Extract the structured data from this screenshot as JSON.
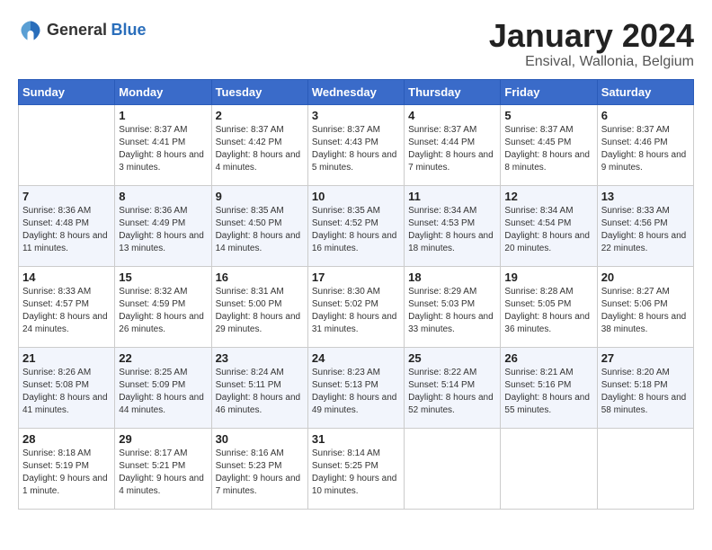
{
  "logo": {
    "general": "General",
    "blue": "Blue"
  },
  "title": "January 2024",
  "subtitle": "Ensival, Wallonia, Belgium",
  "days_header": [
    "Sunday",
    "Monday",
    "Tuesday",
    "Wednesday",
    "Thursday",
    "Friday",
    "Saturday"
  ],
  "weeks": [
    [
      {
        "day": "",
        "info": ""
      },
      {
        "day": "1",
        "info": "Sunrise: 8:37 AM\nSunset: 4:41 PM\nDaylight: 8 hours\nand 3 minutes."
      },
      {
        "day": "2",
        "info": "Sunrise: 8:37 AM\nSunset: 4:42 PM\nDaylight: 8 hours\nand 4 minutes."
      },
      {
        "day": "3",
        "info": "Sunrise: 8:37 AM\nSunset: 4:43 PM\nDaylight: 8 hours\nand 5 minutes."
      },
      {
        "day": "4",
        "info": "Sunrise: 8:37 AM\nSunset: 4:44 PM\nDaylight: 8 hours\nand 7 minutes."
      },
      {
        "day": "5",
        "info": "Sunrise: 8:37 AM\nSunset: 4:45 PM\nDaylight: 8 hours\nand 8 minutes."
      },
      {
        "day": "6",
        "info": "Sunrise: 8:37 AM\nSunset: 4:46 PM\nDaylight: 8 hours\nand 9 minutes."
      }
    ],
    [
      {
        "day": "7",
        "info": "Sunrise: 8:36 AM\nSunset: 4:48 PM\nDaylight: 8 hours\nand 11 minutes."
      },
      {
        "day": "8",
        "info": "Sunrise: 8:36 AM\nSunset: 4:49 PM\nDaylight: 8 hours\nand 13 minutes."
      },
      {
        "day": "9",
        "info": "Sunrise: 8:35 AM\nSunset: 4:50 PM\nDaylight: 8 hours\nand 14 minutes."
      },
      {
        "day": "10",
        "info": "Sunrise: 8:35 AM\nSunset: 4:52 PM\nDaylight: 8 hours\nand 16 minutes."
      },
      {
        "day": "11",
        "info": "Sunrise: 8:34 AM\nSunset: 4:53 PM\nDaylight: 8 hours\nand 18 minutes."
      },
      {
        "day": "12",
        "info": "Sunrise: 8:34 AM\nSunset: 4:54 PM\nDaylight: 8 hours\nand 20 minutes."
      },
      {
        "day": "13",
        "info": "Sunrise: 8:33 AM\nSunset: 4:56 PM\nDaylight: 8 hours\nand 22 minutes."
      }
    ],
    [
      {
        "day": "14",
        "info": "Sunrise: 8:33 AM\nSunset: 4:57 PM\nDaylight: 8 hours\nand 24 minutes."
      },
      {
        "day": "15",
        "info": "Sunrise: 8:32 AM\nSunset: 4:59 PM\nDaylight: 8 hours\nand 26 minutes."
      },
      {
        "day": "16",
        "info": "Sunrise: 8:31 AM\nSunset: 5:00 PM\nDaylight: 8 hours\nand 29 minutes."
      },
      {
        "day": "17",
        "info": "Sunrise: 8:30 AM\nSunset: 5:02 PM\nDaylight: 8 hours\nand 31 minutes."
      },
      {
        "day": "18",
        "info": "Sunrise: 8:29 AM\nSunset: 5:03 PM\nDaylight: 8 hours\nand 33 minutes."
      },
      {
        "day": "19",
        "info": "Sunrise: 8:28 AM\nSunset: 5:05 PM\nDaylight: 8 hours\nand 36 minutes."
      },
      {
        "day": "20",
        "info": "Sunrise: 8:27 AM\nSunset: 5:06 PM\nDaylight: 8 hours\nand 38 minutes."
      }
    ],
    [
      {
        "day": "21",
        "info": "Sunrise: 8:26 AM\nSunset: 5:08 PM\nDaylight: 8 hours\nand 41 minutes."
      },
      {
        "day": "22",
        "info": "Sunrise: 8:25 AM\nSunset: 5:09 PM\nDaylight: 8 hours\nand 44 minutes."
      },
      {
        "day": "23",
        "info": "Sunrise: 8:24 AM\nSunset: 5:11 PM\nDaylight: 8 hours\nand 46 minutes."
      },
      {
        "day": "24",
        "info": "Sunrise: 8:23 AM\nSunset: 5:13 PM\nDaylight: 8 hours\nand 49 minutes."
      },
      {
        "day": "25",
        "info": "Sunrise: 8:22 AM\nSunset: 5:14 PM\nDaylight: 8 hours\nand 52 minutes."
      },
      {
        "day": "26",
        "info": "Sunrise: 8:21 AM\nSunset: 5:16 PM\nDaylight: 8 hours\nand 55 minutes."
      },
      {
        "day": "27",
        "info": "Sunrise: 8:20 AM\nSunset: 5:18 PM\nDaylight: 8 hours\nand 58 minutes."
      }
    ],
    [
      {
        "day": "28",
        "info": "Sunrise: 8:18 AM\nSunset: 5:19 PM\nDaylight: 9 hours\nand 1 minute."
      },
      {
        "day": "29",
        "info": "Sunrise: 8:17 AM\nSunset: 5:21 PM\nDaylight: 9 hours\nand 4 minutes."
      },
      {
        "day": "30",
        "info": "Sunrise: 8:16 AM\nSunset: 5:23 PM\nDaylight: 9 hours\nand 7 minutes."
      },
      {
        "day": "31",
        "info": "Sunrise: 8:14 AM\nSunset: 5:25 PM\nDaylight: 9 hours\nand 10 minutes."
      },
      {
        "day": "",
        "info": ""
      },
      {
        "day": "",
        "info": ""
      },
      {
        "day": "",
        "info": ""
      }
    ]
  ]
}
